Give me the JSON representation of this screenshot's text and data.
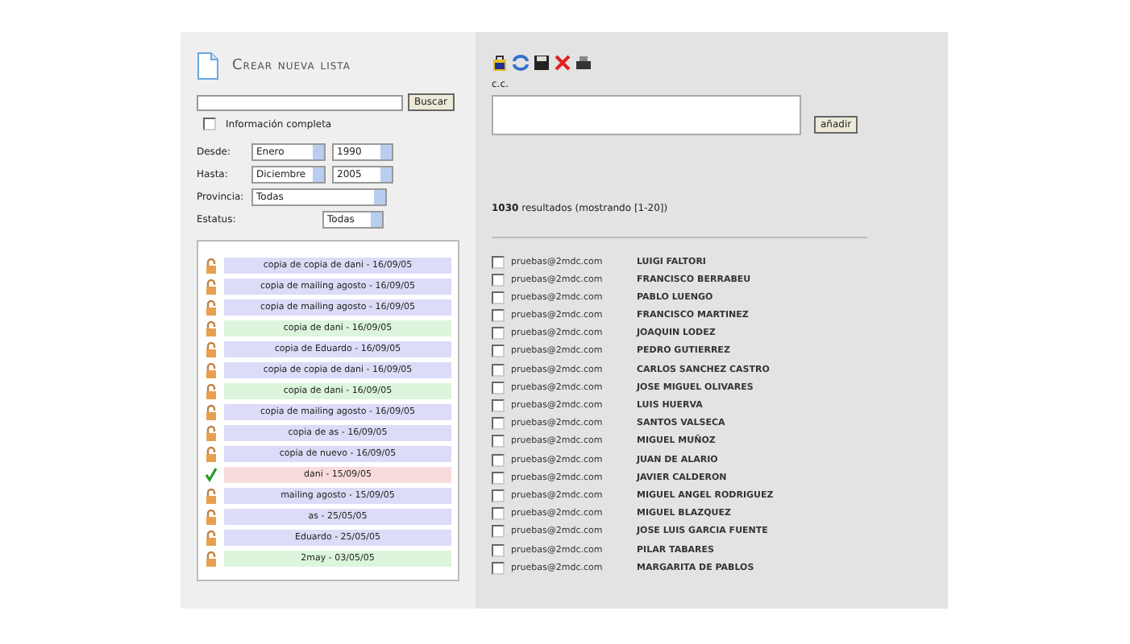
{
  "left_panel": {
    "title": "Crear nueva lista",
    "search_button": "Buscar",
    "full_info": {
      "label": "Información completa",
      "checked": false
    },
    "filters": [
      {
        "label": "Desde:",
        "selects": [
          "Enero",
          "1990"
        ]
      },
      {
        "label": "Hasta:",
        "selects": [
          "Diciembre",
          "2005"
        ]
      },
      {
        "label": "Provincia:",
        "selects": [
          "Todas"
        ]
      },
      {
        "label": "Estatus:",
        "selects": [
          "Todas"
        ]
      }
    ],
    "lists": [
      {
        "name": "copia de copia de dani - 16/09/05",
        "kind": "lock",
        "color": "#dcdcf8"
      },
      {
        "name": "copia de mailing agosto - 16/09/05",
        "kind": "lock",
        "color": "#dcdcf8"
      },
      {
        "name": "copia de mailing agosto - 16/09/05",
        "kind": "lock",
        "color": "#dcdcf8"
      },
      {
        "name": "copia de dani - 16/09/05",
        "kind": "lock",
        "color": "#dcf5dc"
      },
      {
        "name": "copia de Eduardo - 16/09/05",
        "kind": "lock",
        "color": "#dcdcf8"
      },
      {
        "name": "copia de copia de dani - 16/09/05",
        "kind": "lock",
        "color": "#dcdcf8"
      },
      {
        "name": "copia de dani - 16/09/05",
        "kind": "lock",
        "color": "#dcf5dc"
      },
      {
        "name": "copia de mailing agosto - 16/09/05",
        "kind": "lock",
        "color": "#dcdcf8"
      },
      {
        "name": "copia de as - 16/09/05",
        "kind": "lock",
        "color": "#dcdcf8"
      },
      {
        "name": "copia de nuevo - 16/09/05",
        "kind": "lock",
        "color": "#dcdcf8"
      },
      {
        "name": "dani - 15/09/05",
        "kind": "check",
        "color": "#f8dcdc"
      },
      {
        "name": "mailing agosto - 15/09/05",
        "kind": "lock",
        "color": "#dcdcf8"
      },
      {
        "name": "as - 25/05/05",
        "kind": "lock",
        "color": "#dcdcf8"
      },
      {
        "name": "Eduardo - 25/05/05",
        "kind": "lock",
        "color": "#dcdcf8"
      },
      {
        "name": "2may - 03/05/05",
        "kind": "lock",
        "color": "#dcf5dc"
      }
    ]
  },
  "right_panel": {
    "cc_label": "c.c.",
    "add_button": "añadir",
    "results": "**1030** resultados (mostrando [1-20])",
    "contacts": [
      {
        "email": "pruebas@2mdc.com",
        "name": "LUIGI FALTORI",
        "checked": false
      },
      {
        "email": "pruebas@2mdc.com",
        "name": "FRANCISCO BERRABEU",
        "checked": false
      },
      {
        "email": "pruebas@2mdc.com",
        "name": "PABLO LUENGO",
        "checked": false
      },
      {
        "email": "pruebas@2mdc.com",
        "name": "FRANCISCO MARTINEZ",
        "checked": false
      },
      {
        "email": "pruebas@2mdc.com",
        "name": "JOAQUIN LODEZ",
        "checked": false
      },
      {
        "email": "pruebas@2mdc.com",
        "name": "PEDRO GUTIERREZ",
        "checked": false
      },
      {
        "email": "pruebas@2mdc.com",
        "name": "CARLOS SANCHEZ CASTRO",
        "checked": false
      },
      {
        "email": "pruebas@2mdc.com",
        "name": "JOSE MIGUEL OLIVARES",
        "checked": false
      },
      {
        "email": "pruebas@2mdc.com",
        "name": "LUIS HUERVA",
        "checked": false
      },
      {
        "email": "pruebas@2mdc.com",
        "name": "SANTOS VALSECA",
        "checked": false
      },
      {
        "email": "pruebas@2mdc.com",
        "name": "MIGUEL MUÑOZ",
        "checked": false
      },
      {
        "email": "pruebas@2mdc.com",
        "name": "JUAN DE ALARIO",
        "checked": false
      },
      {
        "email": "pruebas@2mdc.com",
        "name": "JAVIER CALDERON",
        "checked": false
      },
      {
        "email": "pruebas@2mdc.com",
        "name": "MIGUEL ANGEL RODRIGUEZ",
        "checked": false
      },
      {
        "email": "pruebas@2mdc.com",
        "name": "MIGUEL BLAZQUEZ",
        "checked": false
      },
      {
        "email": "pruebas@2mdc.com",
        "name": "JOSE LUIS GARCIA FUENTE",
        "checked": false
      },
      {
        "email": "pruebas@2mdc.com",
        "name": "PILAR TABARES",
        "checked": false
      },
      {
        "email": "pruebas@2mdc.com",
        "name": "MARGARITA DE PABLOS",
        "checked": false
      }
    ]
  }
}
